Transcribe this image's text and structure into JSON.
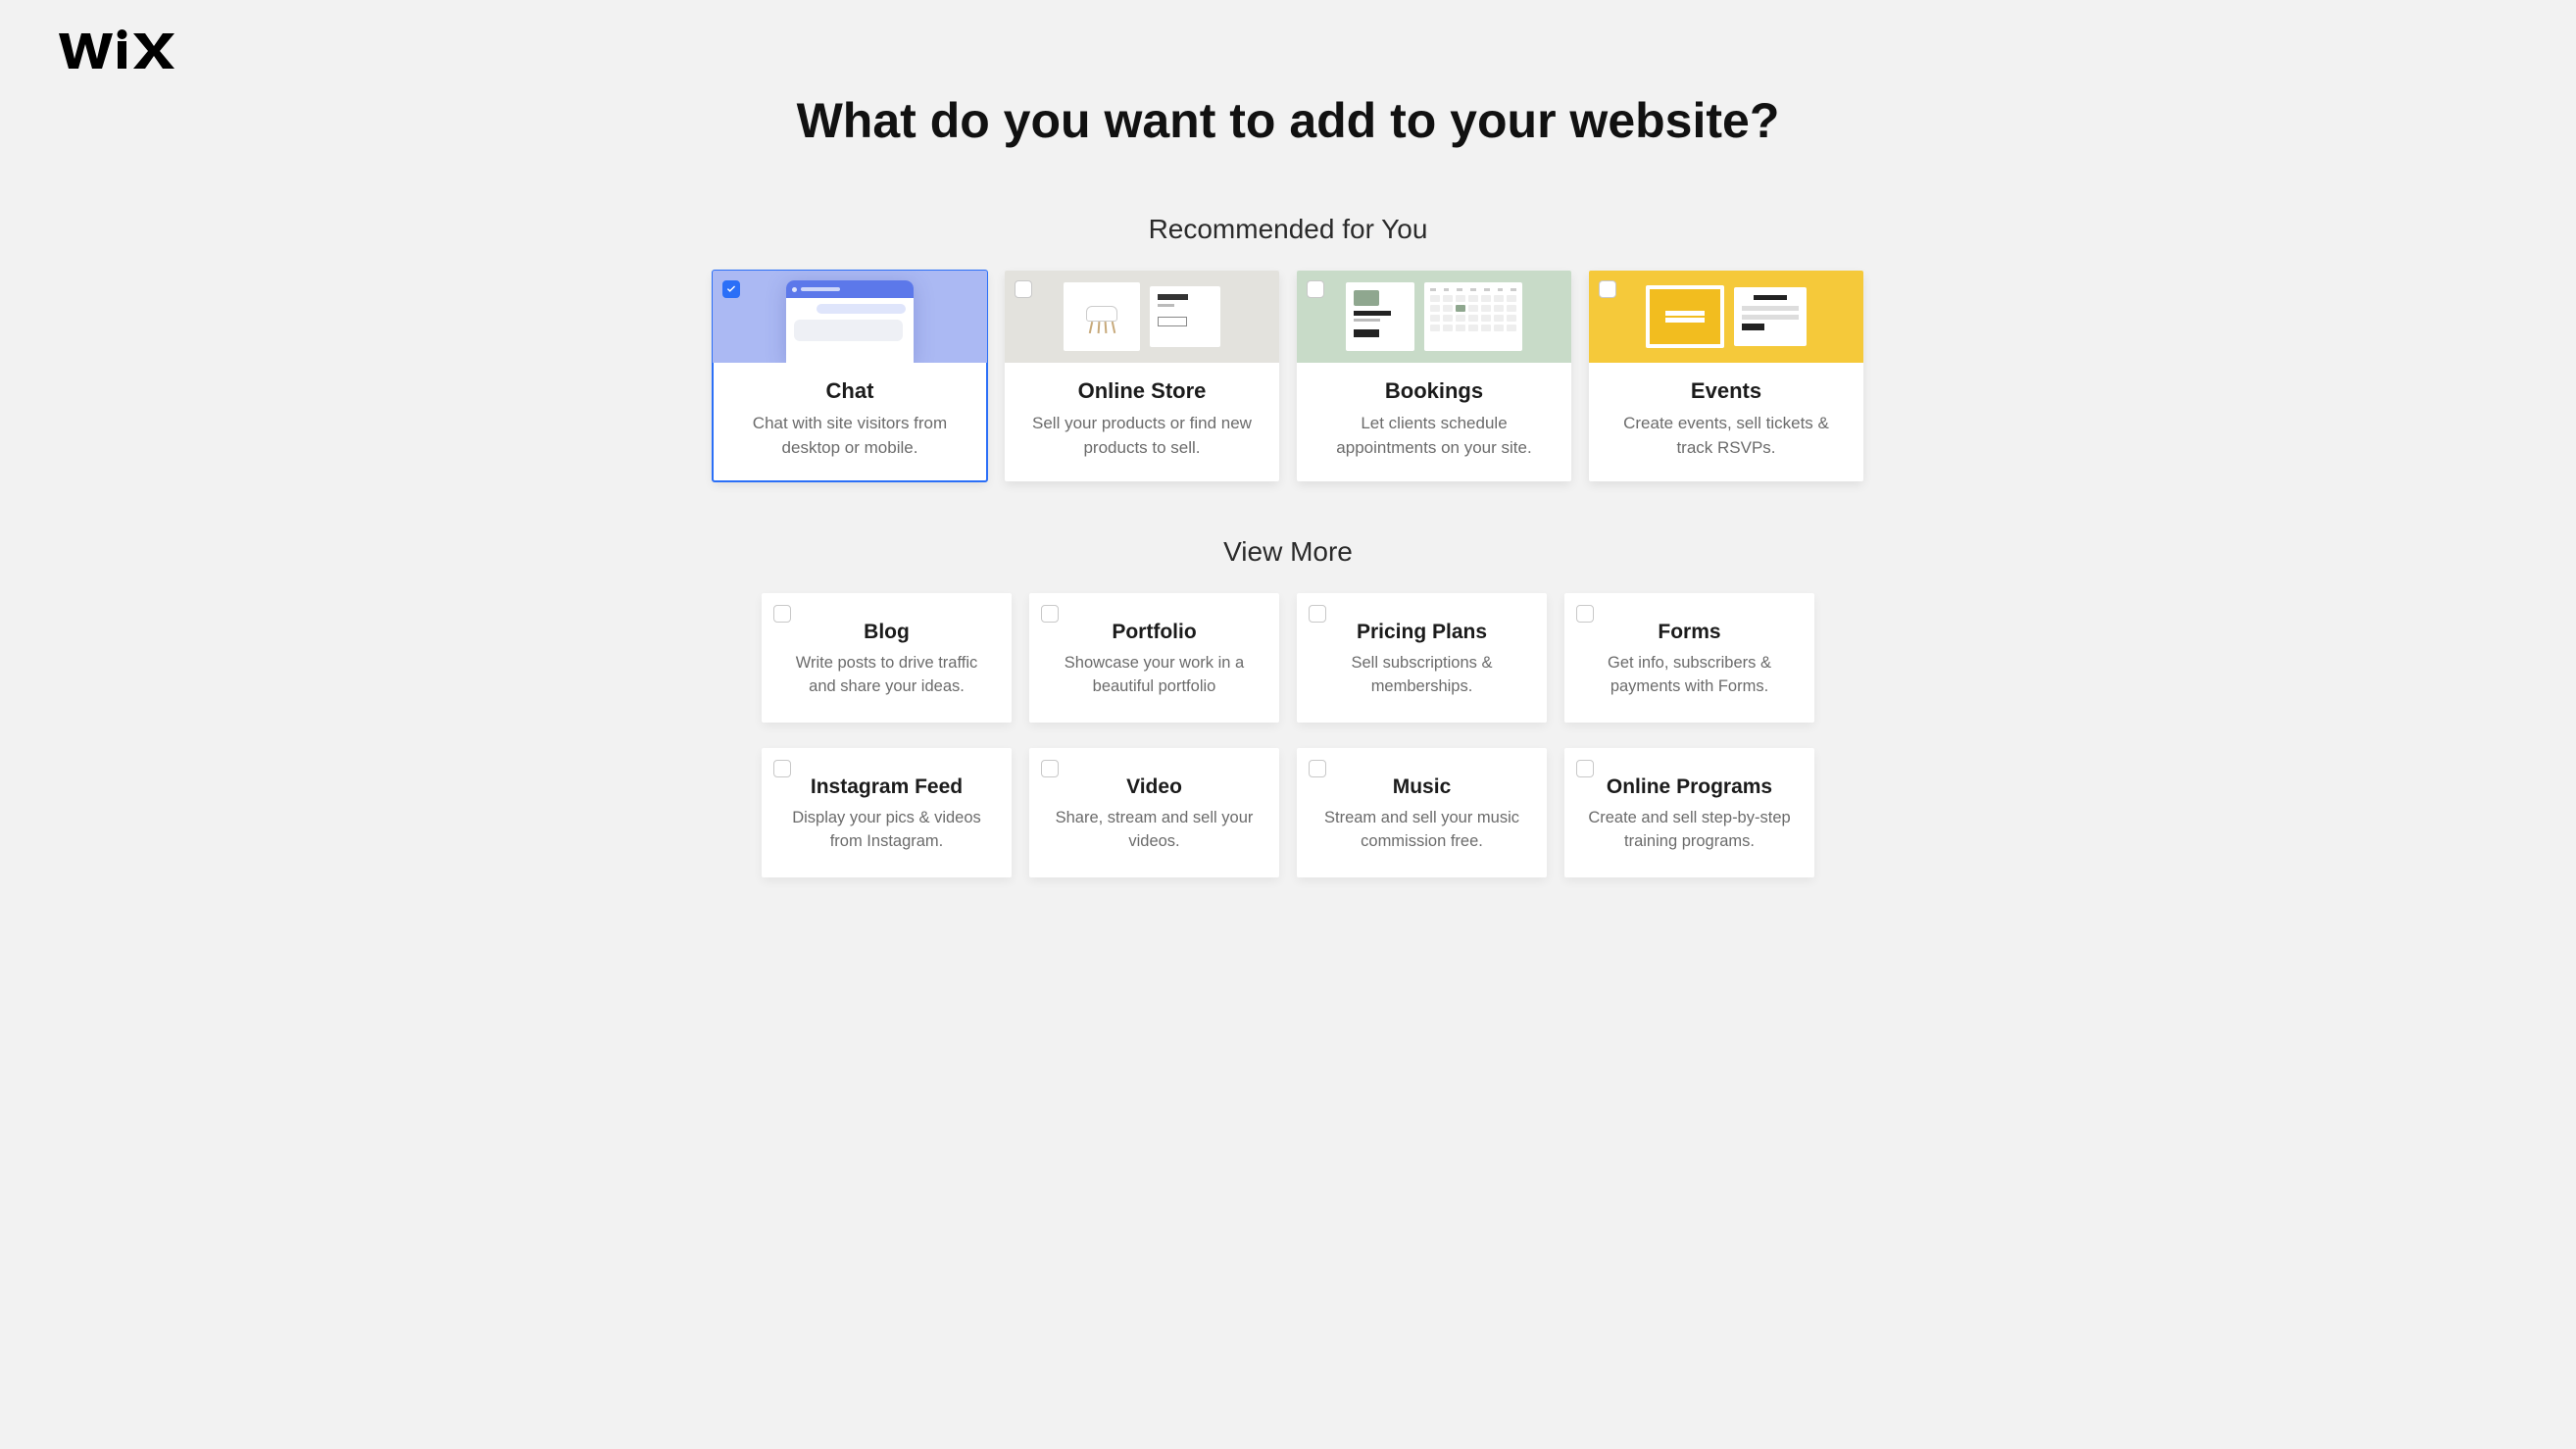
{
  "brand": "WiX",
  "page_title": "What do you want to add to your website?",
  "sections": {
    "recommended": {
      "heading": "Recommended for You",
      "cards": [
        {
          "id": "chat",
          "title": "Chat",
          "desc": "Chat with site visitors from desktop or mobile.",
          "selected": true
        },
        {
          "id": "online-store",
          "title": "Online Store",
          "desc": "Sell your products or find new products to sell.",
          "selected": false
        },
        {
          "id": "bookings",
          "title": "Bookings",
          "desc": "Let clients schedule appointments on your site.",
          "selected": false
        },
        {
          "id": "events",
          "title": "Events",
          "desc": "Create events, sell tickets & track RSVPs.",
          "selected": false
        }
      ]
    },
    "more": {
      "heading": "View More",
      "cards": [
        {
          "id": "blog",
          "title": "Blog",
          "desc": "Write posts to drive traffic and share your ideas.",
          "selected": false
        },
        {
          "id": "portfolio",
          "title": "Portfolio",
          "desc": "Showcase your work in a beautiful portfolio",
          "selected": false
        },
        {
          "id": "pricing-plans",
          "title": "Pricing Plans",
          "desc": "Sell subscriptions & memberships.",
          "selected": false
        },
        {
          "id": "forms",
          "title": "Forms",
          "desc": "Get info, subscribers & payments with Forms.",
          "selected": false
        },
        {
          "id": "instagram-feed",
          "title": "Instagram Feed",
          "desc": "Display your pics & videos from Instagram.",
          "selected": false
        },
        {
          "id": "video",
          "title": "Video",
          "desc": "Share, stream and sell your videos.",
          "selected": false
        },
        {
          "id": "music",
          "title": "Music",
          "desc": "Stream and sell your music commission free.",
          "selected": false
        },
        {
          "id": "online-programs",
          "title": "Online Programs",
          "desc": "Create and sell step-by-step training programs.",
          "selected": false
        }
      ]
    }
  },
  "colors": {
    "accent": "#2b6ff7"
  }
}
